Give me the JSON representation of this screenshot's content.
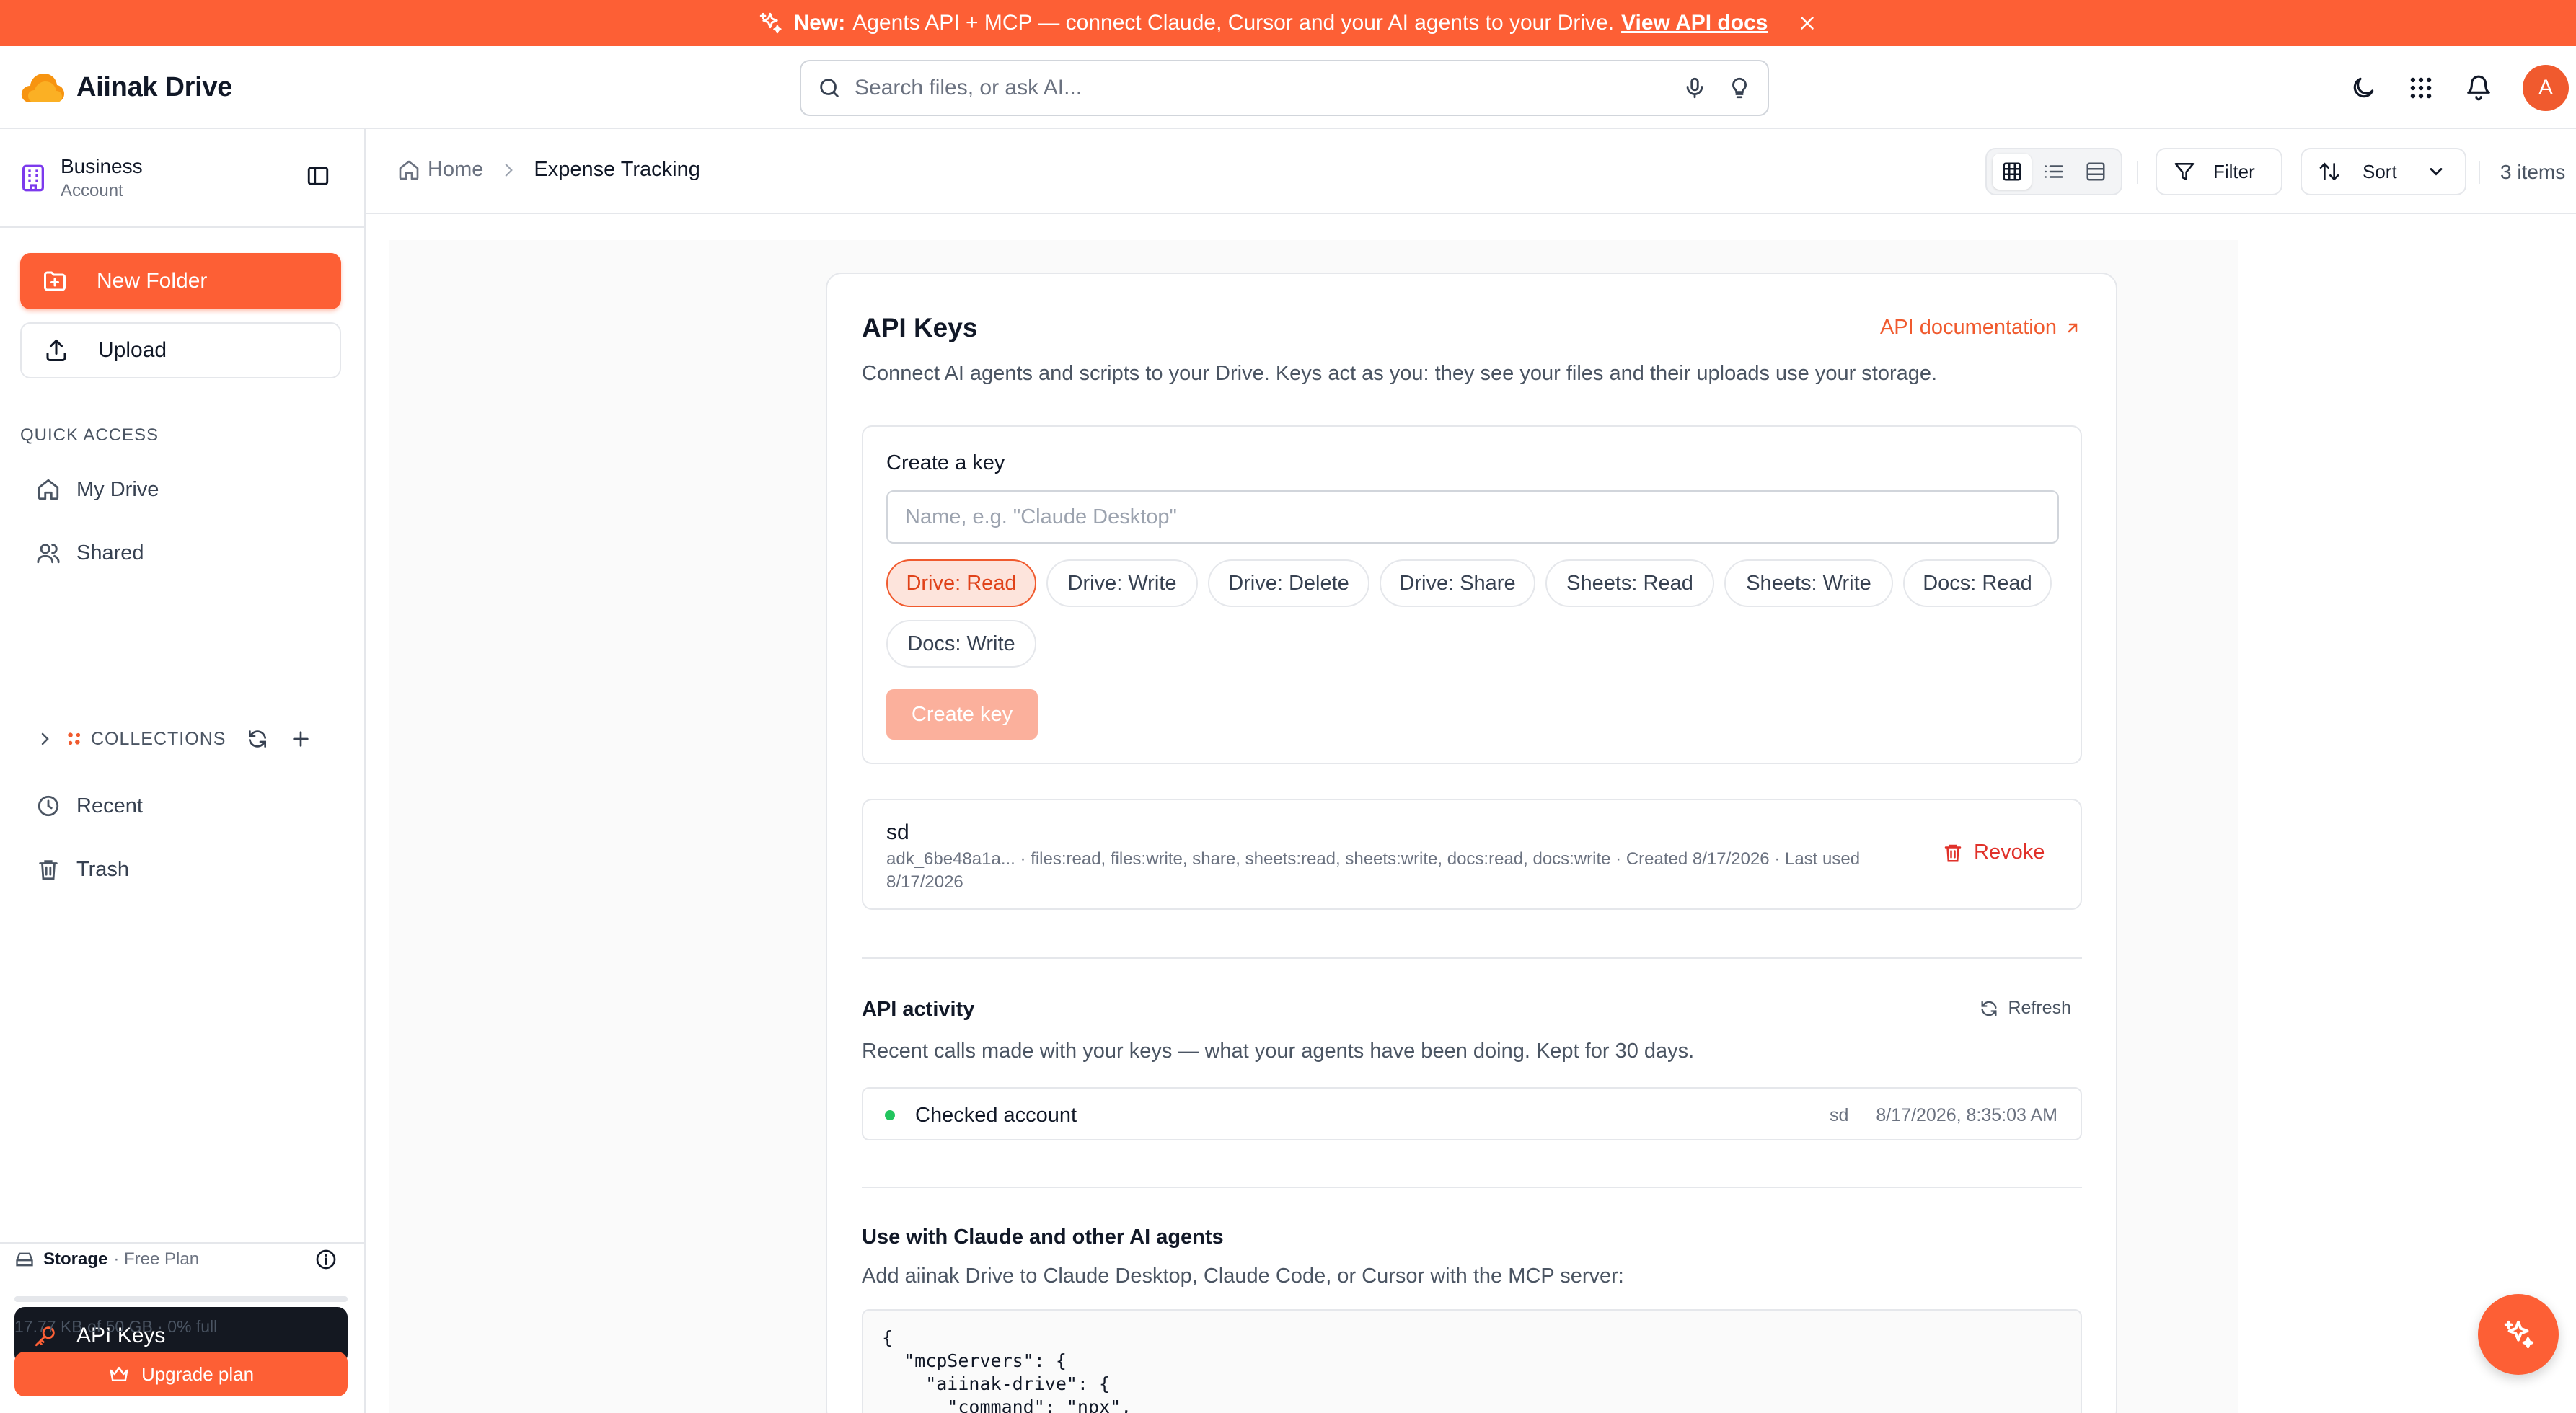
{
  "banner": {
    "badge": "New:",
    "text": "Agents API + MCP — connect Claude, Cursor and your AI agents to your Drive.",
    "link": "View API docs"
  },
  "app": {
    "name": "Aiinak Drive"
  },
  "search": {
    "placeholder": "Search files, or ask AI..."
  },
  "user": {
    "initial": "A"
  },
  "sidebar": {
    "account_title": "Business",
    "account_sub": "Account",
    "new_folder": "New Folder",
    "upload": "Upload",
    "quick_access": "QUICK ACCESS",
    "items": [
      {
        "label": "My Drive",
        "icon": "home-icon"
      },
      {
        "label": "Shared",
        "icon": "users-icon"
      },
      {
        "label": "Recent",
        "icon": "clock-icon"
      },
      {
        "label": "Trash",
        "icon": "trash-icon"
      }
    ],
    "collections": "COLLECTIONS",
    "api_keys": "API Keys",
    "storage_label": "Storage",
    "storage_plan": "· Free Plan",
    "storage_usage": "17.77 KB of 50 GB · 0% full",
    "storage_fraction": 0.0,
    "upgrade": "Upgrade plan"
  },
  "breadcrumb": {
    "home": "Home",
    "current": "Expense Tracking"
  },
  "toolbar": {
    "filter": "Filter",
    "sort": "Sort",
    "items_count": "3 items"
  },
  "api_keys": {
    "title": "API Keys",
    "doc_link": "API documentation",
    "description": "Connect AI agents and scripts to your Drive. Keys act as you: they see your files and their uploads use your storage.",
    "create_label": "Create a key",
    "name_placeholder": "Name, e.g. \"Claude Desktop\"",
    "scopes": [
      {
        "label": "Drive: Read",
        "selected": true
      },
      {
        "label": "Drive: Write",
        "selected": false
      },
      {
        "label": "Drive: Delete",
        "selected": false
      },
      {
        "label": "Drive: Share",
        "selected": false
      },
      {
        "label": "Sheets: Read",
        "selected": false
      },
      {
        "label": "Sheets: Write",
        "selected": false
      },
      {
        "label": "Docs: Read",
        "selected": false
      },
      {
        "label": "Docs: Write",
        "selected": false
      }
    ],
    "create_button": "Create key",
    "keys": [
      {
        "name": "sd",
        "meta": "adk_6be48a1a... · files:read, files:write, share, sheets:read, sheets:write, docs:read, docs:write · Created 8/17/2026 · Last used 8/17/2026",
        "revoke": "Revoke"
      }
    ]
  },
  "activity": {
    "title": "API activity",
    "refresh": "Refresh",
    "description": "Recent calls made with your keys — what your agents have been doing. Kept for 30 days.",
    "rows": [
      {
        "action": "Checked account",
        "key": "sd",
        "time": "8/17/2026, 8:35:03 AM"
      }
    ]
  },
  "mcp": {
    "title": "Use with Claude and other AI agents",
    "description": "Add aiinak Drive to Claude Desktop, Claude Code, or Cursor with the MCP server:",
    "code": "{\n  \"mcpServers\": {\n    \"aiinak-drive\": {\n      \"command\": \"npx\","
  },
  "colors": {
    "accent": "#fd5f35",
    "dark": "#141821",
    "success": "#22c55e",
    "danger": "#e0312a"
  }
}
